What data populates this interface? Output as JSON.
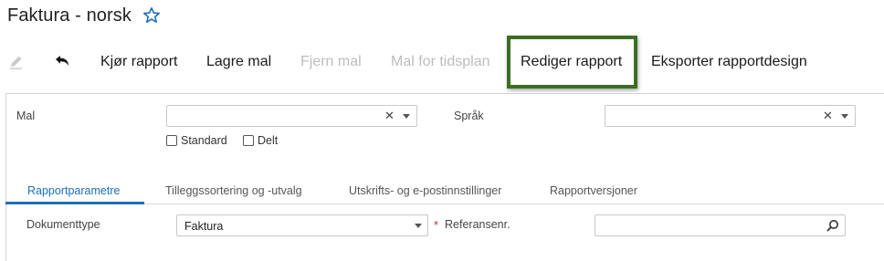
{
  "header": {
    "title": "Faktura - norsk",
    "favorite_icon": "star-outline-icon"
  },
  "toolbar": {
    "edit_icon": "pencil-icon",
    "undo_icon": "undo-icon",
    "run_report": "Kjør rapport",
    "save_template": "Lagre mal",
    "remove_template": "Fjern mal",
    "schedule_template": "Mal for tidsplan",
    "edit_report": "Rediger rapport",
    "export_design": "Eksporter rapportdesign"
  },
  "form": {
    "template_label": "Mal",
    "template_value": "",
    "standard_label": "Standard",
    "shared_label": "Delt",
    "language_label": "Språk",
    "language_value": ""
  },
  "tabs": [
    {
      "label": "Rapportparametre",
      "active": true
    },
    {
      "label": "Tilleggssortering og -utvalg",
      "active": false
    },
    {
      "label": "Utskrifts- og e-postinnstillinger",
      "active": false
    },
    {
      "label": "Rapportversjoner",
      "active": false
    }
  ],
  "params": {
    "doc_type_label": "Dokumenttype",
    "doc_type_value": "Faktura",
    "reference_label": "Referansenr.",
    "reference_value": ""
  },
  "colors": {
    "accent": "#1d6fb8",
    "highlight": "#3b6e22",
    "disabled_text": "#bdbdbd",
    "required": "#c0392b"
  }
}
